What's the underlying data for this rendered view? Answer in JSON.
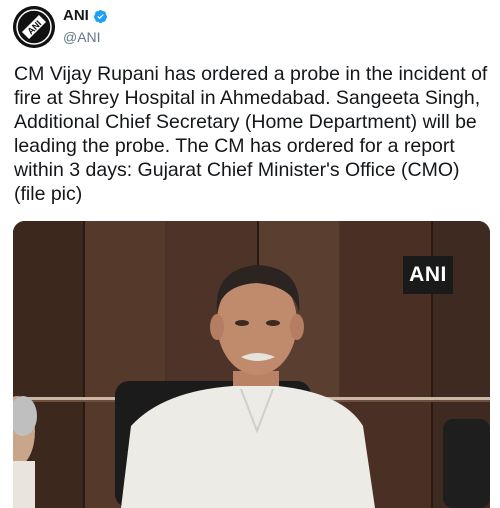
{
  "author": {
    "display_name": "ANI",
    "handle": "@ANI",
    "verified": true,
    "avatar_icon": "ani-logo-icon",
    "verified_icon": "verified-badge-icon"
  },
  "tweet": {
    "text": "CM Vijay Rupani has ordered a probe in the incident of fire at Shrey Hospital in Ahmedabad. Sangeeta Singh, Additional Chief Secretary (Home Department) will be leading the probe. The CM has ordered for a report within 3 days: Gujarat Chief Minister's Office (CMO) (file pic)"
  },
  "media": {
    "watermark": "ANI"
  },
  "colors": {
    "text": "#14171a",
    "secondary": "#657786",
    "verified": "#1da1f2"
  }
}
